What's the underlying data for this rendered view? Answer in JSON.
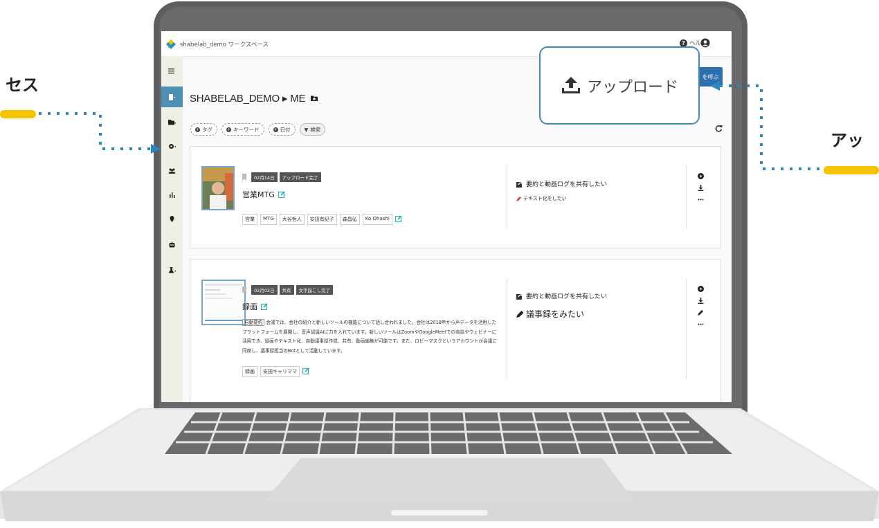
{
  "app": {
    "workspace_name": "shabelab_demo ワークスペース",
    "help_label": "ヘルプ",
    "call_button_label": "を呼ぶ"
  },
  "page": {
    "title": "SHABELAB_DEMO ▸ ME"
  },
  "filters": [
    {
      "label": "タグ"
    },
    {
      "label": "キーワード"
    },
    {
      "label": "日付"
    },
    {
      "label": "検索"
    }
  ],
  "cards": [
    {
      "badges": [
        "02月14日",
        "アップロード完了"
      ],
      "title": "営業MTG",
      "tags": [
        "営業",
        "MTG",
        "大谷哲人",
        "安田有紀子",
        "森昌弘",
        "Ko Ohashi"
      ],
      "share_label": "要約と動画ログを共有したい",
      "sub_action": "テキスト化をしたい"
    },
    {
      "badges": [
        "02月02日",
        "共有",
        "文字起こし完了"
      ],
      "title": "録画",
      "summary_label": "自動要約",
      "summary": "会議では、会社の紹介と新しいツールの機能について話し合われました。会社は2018年から声データを活用したプラットフォームを展開し、音声認識AIに力を入れています。新しいツールはZoomやGoogleMeetでの商談やウェビナーに活用でき、録画やテキスト化、自動議事録作成、共有、動画編集が可能です。また、ロビーマスクというアカウントが会議に同席し、議事録担当のBotとして活動しています。",
      "tags": [
        "録画",
        "安田キャリママ"
      ],
      "share_label": "要約と動画ログを共有したい",
      "sub_action": "議事録をみたい"
    }
  ],
  "callout": {
    "label": "アップロード"
  },
  "annotations": {
    "left_label": "セス",
    "right_label": "アッ"
  },
  "colors": {
    "accent_blue": "#3f8bb8",
    "sidebar_active": "#4d8fb5",
    "highlight_yellow": "#f5c400",
    "edit_teal": "#2bb3b0",
    "pencil_red": "#e04040"
  }
}
